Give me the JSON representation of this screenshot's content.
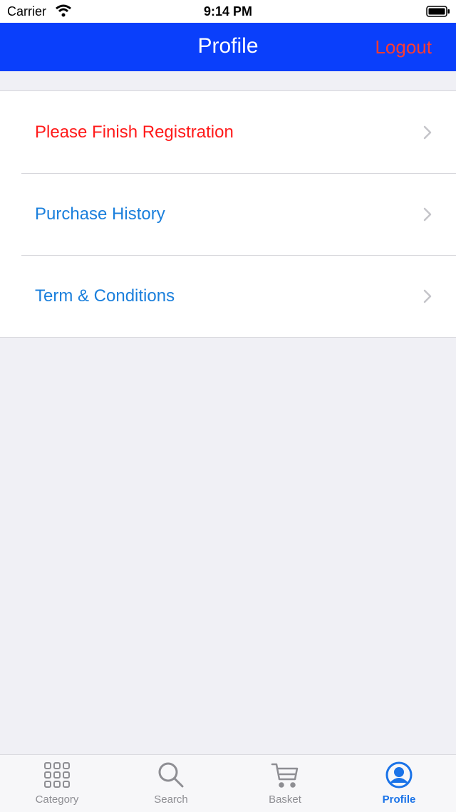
{
  "status_bar": {
    "carrier": "Carrier",
    "time": "9:14 PM"
  },
  "nav": {
    "title": "Profile",
    "logout_label": "Logout"
  },
  "menu": {
    "items": [
      {
        "label": "Please Finish Registration",
        "color": "#ff1a1a"
      },
      {
        "label": "Purchase History",
        "color": "#1a7fdc"
      },
      {
        "label": "Term & Conditions",
        "color": "#1a7fdc"
      }
    ]
  },
  "tabs": [
    {
      "label": "Category",
      "icon": "grid-icon",
      "active": false
    },
    {
      "label": "Search",
      "icon": "search-icon",
      "active": false
    },
    {
      "label": "Basket",
      "icon": "cart-icon",
      "active": false
    },
    {
      "label": "Profile",
      "icon": "person-circle-icon",
      "active": true
    }
  ],
  "colors": {
    "nav_background": "#0a3ffb",
    "logout": "#ff3b30",
    "active_tab": "#1a73e8",
    "inactive_tab": "#8e8e93"
  }
}
